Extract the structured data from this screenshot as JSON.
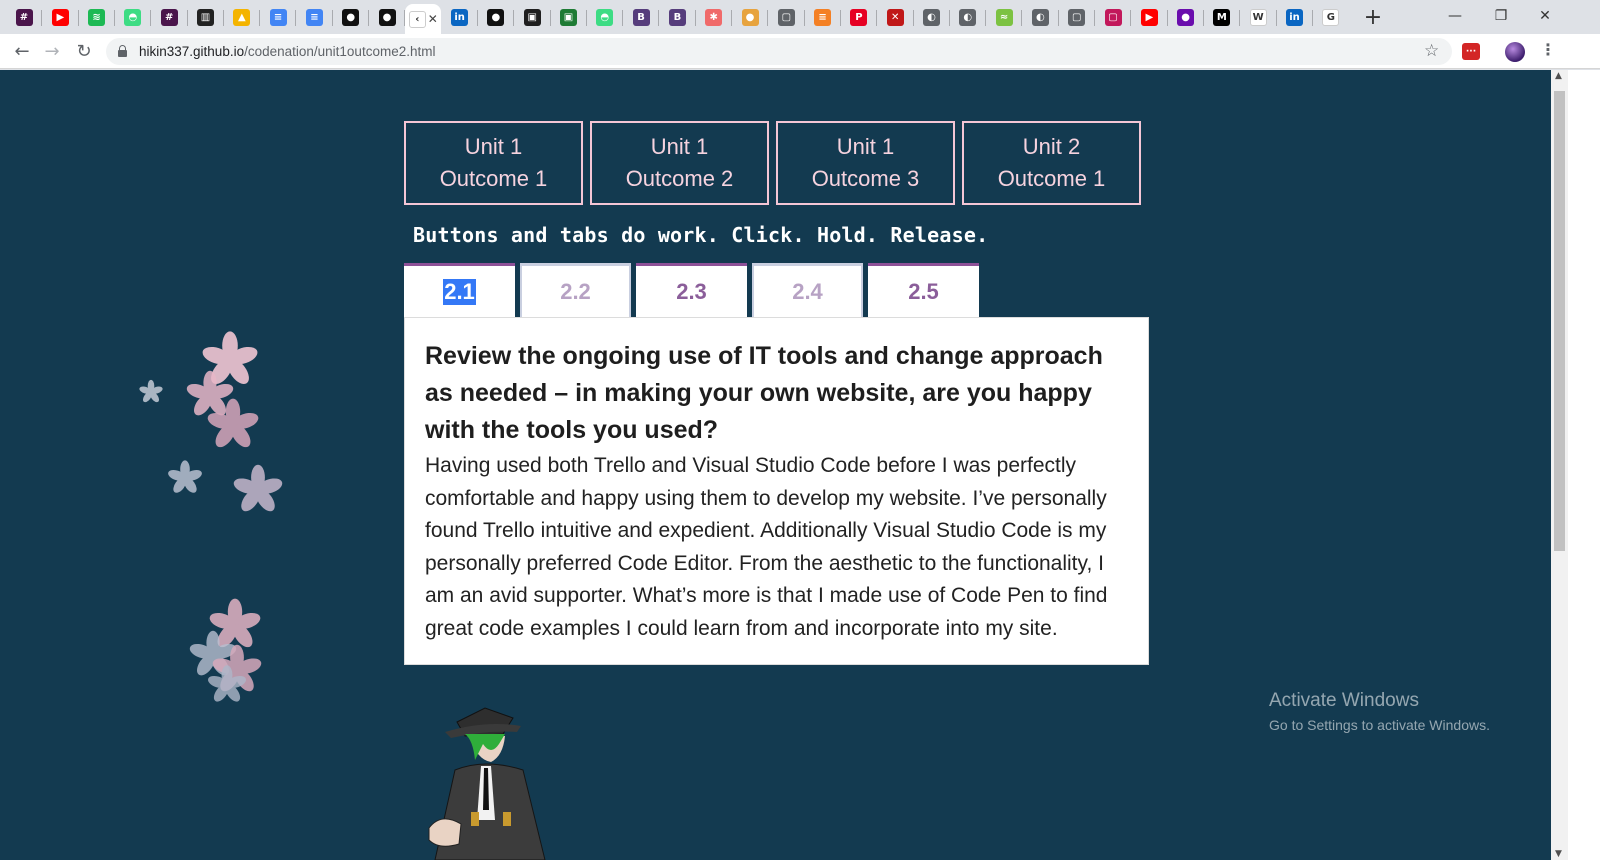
{
  "browser": {
    "pinned_tabs": [
      {
        "icon": "slack-icon",
        "color": "#4a154b",
        "glyph": "#"
      },
      {
        "icon": "youtube-icon",
        "color": "#ff0000",
        "glyph": "▶"
      },
      {
        "icon": "spotify-icon",
        "color": "#1db954",
        "glyph": "≋"
      },
      {
        "icon": "android-icon",
        "color": "#3ddc84",
        "glyph": "◓"
      },
      {
        "icon": "slack-icon",
        "color": "#4a154b",
        "glyph": "#"
      },
      {
        "icon": "trello-icon",
        "color": "#222222",
        "glyph": "▥"
      },
      {
        "icon": "google-drive-icon",
        "color": "#f4b400",
        "glyph": "▲"
      },
      {
        "icon": "google-docs-icon",
        "color": "#4285f4",
        "glyph": "≡"
      },
      {
        "icon": "google-docs-icon",
        "color": "#4285f4",
        "glyph": "≡"
      },
      {
        "icon": "github-icon",
        "color": "#111111",
        "glyph": "●"
      },
      {
        "icon": "github-icon",
        "color": "#111111",
        "glyph": "●"
      },
      {
        "icon": "active-tab-icon",
        "color": "#ffffff",
        "glyph": "‹"
      },
      {
        "icon": "linkedin-icon",
        "color": "#0a66c2",
        "glyph": "in"
      },
      {
        "icon": "github-icon",
        "color": "#111111",
        "glyph": "●"
      },
      {
        "icon": "codecademy-icon",
        "color": "#1f1f1f",
        "glyph": "▣"
      },
      {
        "icon": "code-icon",
        "color": "#1e7b34",
        "glyph": "▣"
      },
      {
        "icon": "android-icon",
        "color": "#3ddc84",
        "glyph": "◓"
      },
      {
        "icon": "bootstrap-icon",
        "color": "#563d7c",
        "glyph": "B"
      },
      {
        "icon": "bootstrap-icon",
        "color": "#563d7c",
        "glyph": "B"
      },
      {
        "icon": "asana-icon",
        "color": "#f06a6a",
        "glyph": "✱"
      },
      {
        "icon": "squirrel-icon",
        "color": "#e7a33e",
        "glyph": "●"
      },
      {
        "icon": "page-icon",
        "color": "#5f6368",
        "glyph": "▢"
      },
      {
        "icon": "stackoverflow-icon",
        "color": "#f48024",
        "glyph": "≡"
      },
      {
        "icon": "pinterest-icon",
        "color": "#e60023",
        "glyph": "P"
      },
      {
        "icon": "game-icon",
        "color": "#c01818",
        "glyph": "✕"
      },
      {
        "icon": "globe-icon",
        "color": "#5f6368",
        "glyph": "◐"
      },
      {
        "icon": "globe-icon",
        "color": "#5f6368",
        "glyph": "◐"
      },
      {
        "icon": "webstack-icon",
        "color": "#7cc242",
        "glyph": "≈"
      },
      {
        "icon": "globe-icon",
        "color": "#5f6368",
        "glyph": "◐"
      },
      {
        "icon": "page-icon",
        "color": "#5f6368",
        "glyph": "▢"
      },
      {
        "icon": "page-icon",
        "color": "#c2185b",
        "glyph": "▢"
      },
      {
        "icon": "youtube-icon",
        "color": "#ff0000",
        "glyph": "▶"
      },
      {
        "icon": "twitch-icon",
        "color": "#6a0dad",
        "glyph": "●"
      },
      {
        "icon": "medium-icon",
        "color": "#000000",
        "glyph": "M"
      },
      {
        "icon": "wikipedia-icon",
        "color": "#ffffff",
        "glyph": "W"
      },
      {
        "icon": "linkedin-icon",
        "color": "#0a66c2",
        "glyph": "in"
      },
      {
        "icon": "google-icon",
        "color": "#ffffff",
        "glyph": "G"
      }
    ],
    "new_tab_label": "+",
    "window_controls": {
      "minimize": "—",
      "restore": "❐",
      "close": "✕"
    },
    "url_host": "hikin337.github.io",
    "url_path": "/codenation/unit1outcome2.html",
    "ext_icon_label": "···"
  },
  "page": {
    "unit_buttons": [
      {
        "line1": "Unit 1",
        "line2": "Outcome 1"
      },
      {
        "line1": "Unit 1",
        "line2": "Outcome 2"
      },
      {
        "line1": "Unit 1",
        "line2": "Outcome 3"
      },
      {
        "line1": "Unit 2",
        "line2": "Outcome 1"
      }
    ],
    "tagline": "Buttons and tabs do work. Click. Hold. Release.",
    "tabs": [
      "2.1",
      "2.2",
      "2.3",
      "2.4",
      "2.5"
    ],
    "selected_tab": "2.1",
    "heading": "Review the ongoing use of IT tools and change approach as needed – in making your own website, are you happy with the tools you used?",
    "body": "Having used both Trello and Visual Studio Code before I was perfectly comfortable and happy using them to develop my website. I’ve personally found Trello intuitive and expedient. Additionally Visual Studio Code is my personally preferred Code Editor. From the aesthetic to the functionality, I am an avid supporter. What’s more is that I made use of Code Pen to find great code examples I could learn from and incorporate into my site.",
    "colors": {
      "background": "#133a50",
      "button_border": "#f4c6d6",
      "tab_accent": "#8e5198",
      "tab_text": "#8b5e9a",
      "tab_text_dim": "#b7a2c4"
    }
  },
  "os_watermark": {
    "title": "Activate Windows",
    "subtitle": "Go to Settings to activate Windows."
  }
}
